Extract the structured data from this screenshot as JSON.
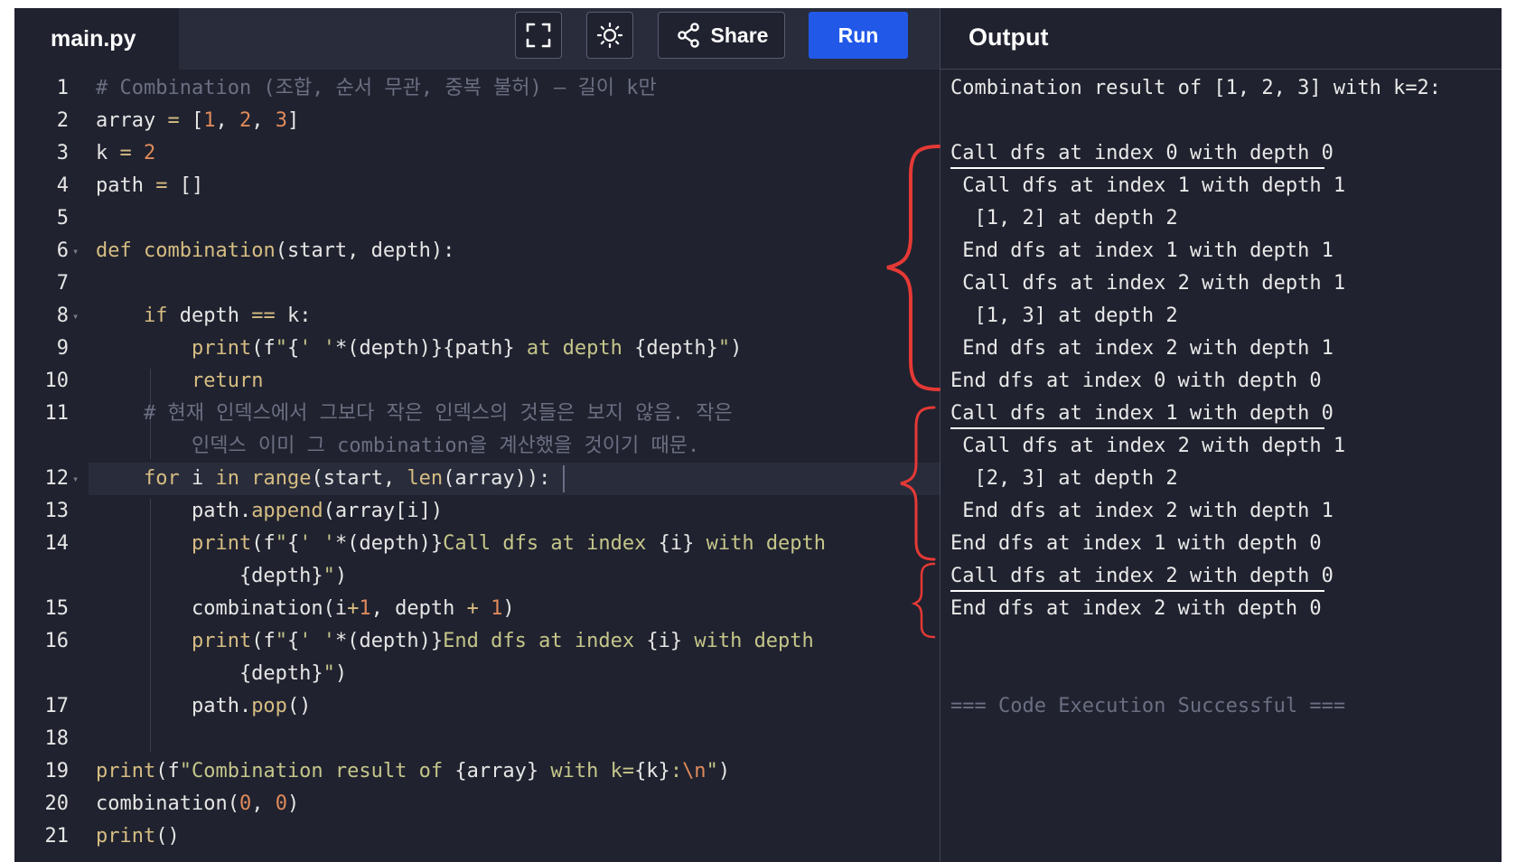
{
  "editor": {
    "file_tab": "main.py",
    "toolbar": {
      "share_label": "Share",
      "run_label": "Run"
    },
    "lines": [
      {
        "n": "1",
        "fold": false,
        "tokens": [
          [
            "cm",
            "# Combination (조합, 순서 무관, 중복 불허) — 길이 k만"
          ]
        ]
      },
      {
        "n": "2",
        "fold": false,
        "tokens": [
          [
            "",
            "array "
          ],
          [
            "op",
            "="
          ],
          [
            "",
            " ["
          ],
          [
            "num",
            "1"
          ],
          [
            "",
            ", "
          ],
          [
            "num",
            "2"
          ],
          [
            "",
            ", "
          ],
          [
            "num",
            "3"
          ],
          [
            "",
            "]"
          ]
        ]
      },
      {
        "n": "3",
        "fold": false,
        "tokens": [
          [
            "",
            "k "
          ],
          [
            "op",
            "="
          ],
          [
            "",
            " "
          ],
          [
            "num",
            "2"
          ]
        ]
      },
      {
        "n": "4",
        "fold": false,
        "tokens": [
          [
            "",
            "path "
          ],
          [
            "op",
            "="
          ],
          [
            "",
            " []"
          ]
        ]
      },
      {
        "n": "5",
        "fold": false,
        "tokens": []
      },
      {
        "n": "6",
        "fold": true,
        "tokens": [
          [
            "kw",
            "def"
          ],
          [
            "",
            " "
          ],
          [
            "fn",
            "combination"
          ],
          [
            "",
            "(start, depth):"
          ]
        ]
      },
      {
        "n": "7",
        "fold": false,
        "tokens": []
      },
      {
        "n": "8",
        "fold": true,
        "tokens": [
          [
            "",
            "    "
          ],
          [
            "kw",
            "if"
          ],
          [
            "",
            " depth "
          ],
          [
            "op",
            "=="
          ],
          [
            "",
            " k:"
          ]
        ]
      },
      {
        "n": "9",
        "fold": false,
        "tokens": [
          [
            "",
            "        "
          ],
          [
            "fn",
            "print"
          ],
          [
            "",
            "(f"
          ],
          [
            "str",
            "\""
          ],
          [
            "",
            "{"
          ],
          [
            "str",
            "' '"
          ],
          [
            "",
            "*(depth)}{path}"
          ],
          [
            "str",
            " at depth "
          ],
          [
            "",
            "{depth}"
          ],
          [
            "str",
            "\""
          ],
          [
            "",
            ")"
          ]
        ]
      },
      {
        "n": "10",
        "fold": false,
        "tokens": [
          [
            "",
            "        "
          ],
          [
            "kw",
            "return"
          ]
        ]
      },
      {
        "n": "11",
        "fold": false,
        "tokens": [
          [
            "cm",
            "    # 현재 인덱스에서 그보다 작은 인덱스의 것들은 보지 않음. 작은"
          ]
        ]
      },
      {
        "n": "",
        "fold": false,
        "tokens": [
          [
            "cm",
            "        인덱스 이미 그 combination을 계산했을 것이기 때문."
          ]
        ]
      },
      {
        "n": "12",
        "fold": true,
        "tokens": [
          [
            "",
            "    "
          ],
          [
            "kw",
            "for"
          ],
          [
            "",
            " i "
          ],
          [
            "kw",
            "in"
          ],
          [
            "",
            " "
          ],
          [
            "fn",
            "range"
          ],
          [
            "",
            "(start, "
          ],
          [
            "fn",
            "len"
          ],
          [
            "",
            "(array)):"
          ]
        ]
      },
      {
        "n": "13",
        "fold": false,
        "tokens": [
          [
            "",
            "        path."
          ],
          [
            "fn",
            "append"
          ],
          [
            "",
            "(array[i])"
          ]
        ]
      },
      {
        "n": "14",
        "fold": false,
        "tokens": [
          [
            "",
            "        "
          ],
          [
            "fn",
            "print"
          ],
          [
            "",
            "(f"
          ],
          [
            "str",
            "\""
          ],
          [
            "",
            "{"
          ],
          [
            "str",
            "' '"
          ],
          [
            "",
            "*(depth)}"
          ],
          [
            "str",
            "Call dfs at index "
          ],
          [
            "",
            "{i}"
          ],
          [
            "str",
            " with depth"
          ]
        ]
      },
      {
        "n": "",
        "fold": false,
        "tokens": [
          [
            "",
            "            {depth}"
          ],
          [
            "str",
            "\""
          ],
          [
            "",
            ")"
          ]
        ]
      },
      {
        "n": "15",
        "fold": false,
        "tokens": [
          [
            "",
            "        combination(i"
          ],
          [
            "op",
            "+"
          ],
          [
            "num",
            "1"
          ],
          [
            "",
            ", depth "
          ],
          [
            "op",
            "+"
          ],
          [
            "",
            " "
          ],
          [
            "num",
            "1"
          ],
          [
            "",
            ")"
          ]
        ]
      },
      {
        "n": "16",
        "fold": false,
        "tokens": [
          [
            "",
            "        "
          ],
          [
            "fn",
            "print"
          ],
          [
            "",
            "(f"
          ],
          [
            "str",
            "\""
          ],
          [
            "",
            "{"
          ],
          [
            "str",
            "' '"
          ],
          [
            "",
            "*(depth)}"
          ],
          [
            "str",
            "End dfs at index "
          ],
          [
            "",
            "{i}"
          ],
          [
            "str",
            " with depth"
          ]
        ]
      },
      {
        "n": "",
        "fold": false,
        "tokens": [
          [
            "",
            "            {depth}"
          ],
          [
            "str",
            "\""
          ],
          [
            "",
            ")"
          ]
        ]
      },
      {
        "n": "17",
        "fold": false,
        "tokens": [
          [
            "",
            "        path."
          ],
          [
            "fn",
            "pop"
          ],
          [
            "",
            "()"
          ]
        ]
      },
      {
        "n": "18",
        "fold": false,
        "tokens": []
      },
      {
        "n": "19",
        "fold": false,
        "tokens": [
          [
            "fn",
            "print"
          ],
          [
            "",
            "(f"
          ],
          [
            "str",
            "\"Combination result of "
          ],
          [
            "",
            "{array}"
          ],
          [
            "str",
            " with k="
          ],
          [
            "",
            "{k}"
          ],
          [
            "str",
            ":"
          ],
          [
            "num",
            "\\n"
          ],
          [
            "str",
            "\""
          ],
          [
            "",
            ")"
          ]
        ]
      },
      {
        "n": "20",
        "fold": false,
        "tokens": [
          [
            "",
            "combination("
          ],
          [
            "num",
            "0"
          ],
          [
            "",
            ", "
          ],
          [
            "num",
            "0"
          ],
          [
            "",
            ")"
          ]
        ]
      },
      {
        "n": "21",
        "fold": false,
        "tokens": [
          [
            "fn",
            "print"
          ],
          [
            "",
            "()"
          ]
        ]
      }
    ]
  },
  "output": {
    "title": "Output",
    "lines": [
      "Combination result of [1, 2, 3] with k=2:",
      "",
      "Call dfs at index 0 with depth 0",
      " Call dfs at index 1 with depth 1",
      "  [1, 2] at depth 2",
      " End dfs at index 1 with depth 1",
      " Call dfs at index 2 with depth 1",
      "  [1, 3] at depth 2",
      " End dfs at index 2 with depth 1",
      "End dfs at index 0 with depth 0",
      "Call dfs at index 1 with depth 0",
      " Call dfs at index 2 with depth 1",
      "  [2, 3] at depth 2",
      " End dfs at index 2 with depth 1",
      "End dfs at index 1 with depth 0",
      "Call dfs at index 2 with depth 0",
      "End dfs at index 2 with depth 0",
      "",
      "",
      "=== Code Execution Successful ==="
    ]
  },
  "annotation_color": "#e53935"
}
